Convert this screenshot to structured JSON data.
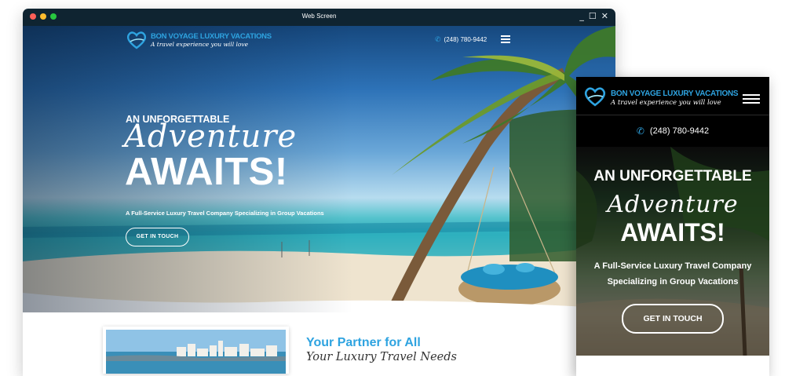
{
  "window": {
    "title": "Web Screen",
    "controls": [
      "_",
      "☐",
      "✕"
    ]
  },
  "desktop": {
    "logo": {
      "brand": "BON VOYAGE LUXURY VACATIONS",
      "tagline": "A travel experience you will love"
    },
    "phone": "(248) 780-9442",
    "hero": {
      "kicker": "AN UNFORGETTABLE",
      "script": "Adventure",
      "headline": "AWAITS!",
      "subtitle": "A Full-Service Luxury Travel Company Specializing in Group Vacations",
      "cta": "GET IN TOUCH"
    },
    "partner": {
      "title": "Your Partner for All",
      "script": "Your Luxury Travel Needs"
    }
  },
  "mobile": {
    "logo": {
      "brand": "BON VOYAGE LUXURY VACATIONS",
      "tagline": "A travel experience you will love"
    },
    "phone": "(248) 780-9442",
    "hero": {
      "kicker": "AN UNFORGETTABLE",
      "script": "Adventure",
      "headline": "AWAITS!",
      "subtitle": "A Full-Service Luxury Travel Company Specializing in Group Vacations",
      "cta": "GET IN TOUCH"
    }
  },
  "icons": {
    "phone": "phone-icon",
    "menu": "hamburger-menu-icon",
    "logo": "heart-logo-icon"
  },
  "colors": {
    "brand_blue": "#2ea3e0",
    "titlebar": "#0f2431",
    "header_bg": "#000000"
  }
}
